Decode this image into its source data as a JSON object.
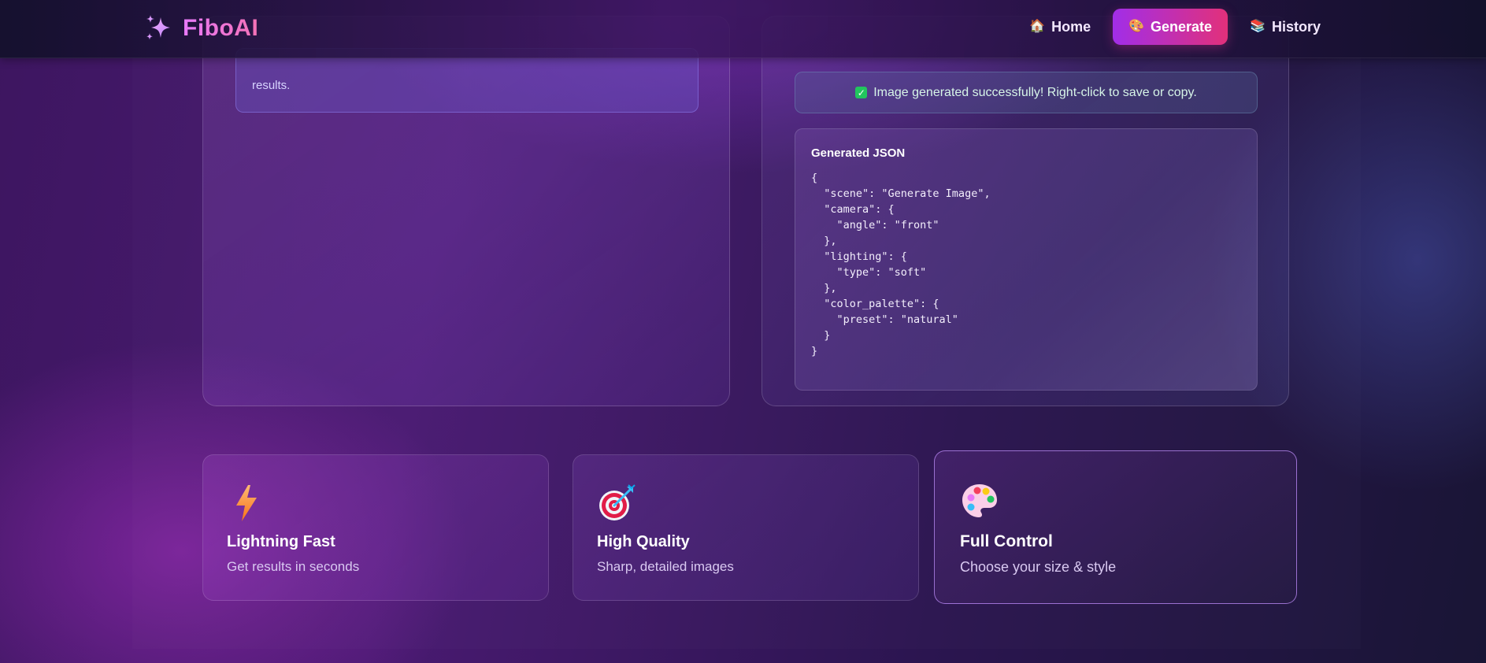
{
  "brand": {
    "name": "FiboAI",
    "icon": "sparkles-icon"
  },
  "nav": {
    "items": [
      {
        "label": "Home",
        "icon": "house-icon",
        "emoji": "🏠",
        "active": false
      },
      {
        "label": "Generate",
        "icon": "palette-icon",
        "emoji": "🎨",
        "active": true
      },
      {
        "label": "History",
        "icon": "books-icon",
        "emoji": "📚",
        "active": false
      }
    ]
  },
  "left_panel": {
    "tip_text": "results."
  },
  "right_panel": {
    "success_message": "Image generated successfully! Right-click to save or copy.",
    "json_title": "Generated JSON",
    "json_code": "{\n  \"scene\": \"Generate Image\",\n  \"camera\": {\n    \"angle\": \"front\"\n  },\n  \"lighting\": {\n    \"type\": \"soft\"\n  },\n  \"color_palette\": {\n    \"preset\": \"natural\"\n  }\n}"
  },
  "features": [
    {
      "title": "Lightning Fast",
      "description": "Get results in seconds",
      "icon": "lightning-icon"
    },
    {
      "title": "High Quality",
      "description": "Sharp, detailed images",
      "icon": "target-icon"
    },
    {
      "title": "Full Control",
      "description": "Choose your size & style",
      "icon": "palette-icon"
    }
  ],
  "colors": {
    "accent_from": "#a12ee8",
    "accent_to": "#e2307a",
    "brand": "#e879f9",
    "success": "#22c55e"
  }
}
